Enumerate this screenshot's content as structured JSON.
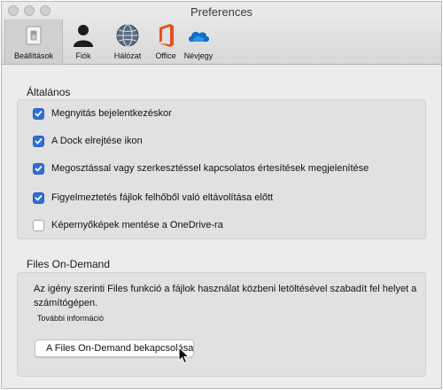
{
  "window": {
    "title": "Preferences"
  },
  "toolbar": {
    "tabs": [
      {
        "id": "settings",
        "label": "Beállítások",
        "icon": "switch-icon",
        "selected": true
      },
      {
        "id": "account",
        "label": "Fiók",
        "icon": "person-icon",
        "selected": false
      },
      {
        "id": "network",
        "label": "Hálózat",
        "icon": "globe-icon",
        "selected": false
      },
      {
        "id": "office",
        "label": "Office",
        "icon": "office-logo-icon",
        "selected": false
      },
      {
        "id": "about",
        "label": "Névjegy",
        "icon": "onedrive-cloud-icon",
        "selected": false
      }
    ]
  },
  "general": {
    "label": "Általános",
    "options": [
      {
        "label": "Megnyitás bejelentkezéskor",
        "checked": true
      },
      {
        "label": "A Dock elrejtése ikon",
        "checked": true
      },
      {
        "label": "Megosztással vagy szerkesztéssel kapcsolatos értesítések megjelenítése",
        "checked": true
      },
      {
        "label": "Figyelmeztetés fájlok felhőből való eltávolítása előtt",
        "checked": true
      },
      {
        "label": "Képernyőképek mentése a OneDrive-ra",
        "checked": false
      }
    ]
  },
  "files_on_demand": {
    "label": "Files On-Demand",
    "description": "Az igény szerinti Files funkció a fájlok használat közbeni letöltésével szabadít fel helyet a számítógépen.",
    "more_info": "További információ",
    "button_label": "A Files On-Demand bekapcsolása"
  },
  "colors": {
    "checkbox_accent": "#2f6fd6",
    "office_orange": "#e8501c",
    "onedrive_blue": "#0f6cc7"
  }
}
